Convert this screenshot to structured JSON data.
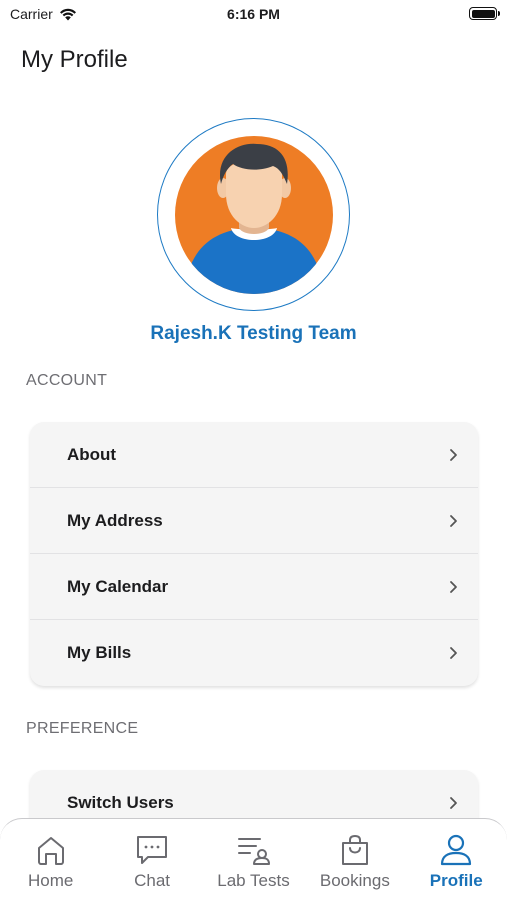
{
  "status_bar": {
    "carrier": "Carrier",
    "time": "6:16 PM"
  },
  "header": {
    "title": "My Profile"
  },
  "profile": {
    "name": "Rajesh.K Testing Team"
  },
  "sections": {
    "account": {
      "label": "ACCOUNT",
      "items": [
        {
          "label": "About"
        },
        {
          "label": "My Address"
        },
        {
          "label": "My Calendar"
        },
        {
          "label": "My Bills"
        }
      ]
    },
    "preference": {
      "label": "PREFERENCE",
      "items": [
        {
          "label": "Switch Users"
        }
      ]
    }
  },
  "tab_bar": {
    "tabs": [
      {
        "label": "Home",
        "icon": "home-icon"
      },
      {
        "label": "Chat",
        "icon": "chat-icon"
      },
      {
        "label": "Lab Tests",
        "icon": "lab-tests-icon"
      },
      {
        "label": "Bookings",
        "icon": "bookings-icon"
      },
      {
        "label": "Profile",
        "icon": "profile-icon"
      }
    ],
    "active": "Profile"
  },
  "colors": {
    "accent": "#1a72b8",
    "avatar_bg": "#ee7d25",
    "card_bg": "#f5f5f5"
  }
}
